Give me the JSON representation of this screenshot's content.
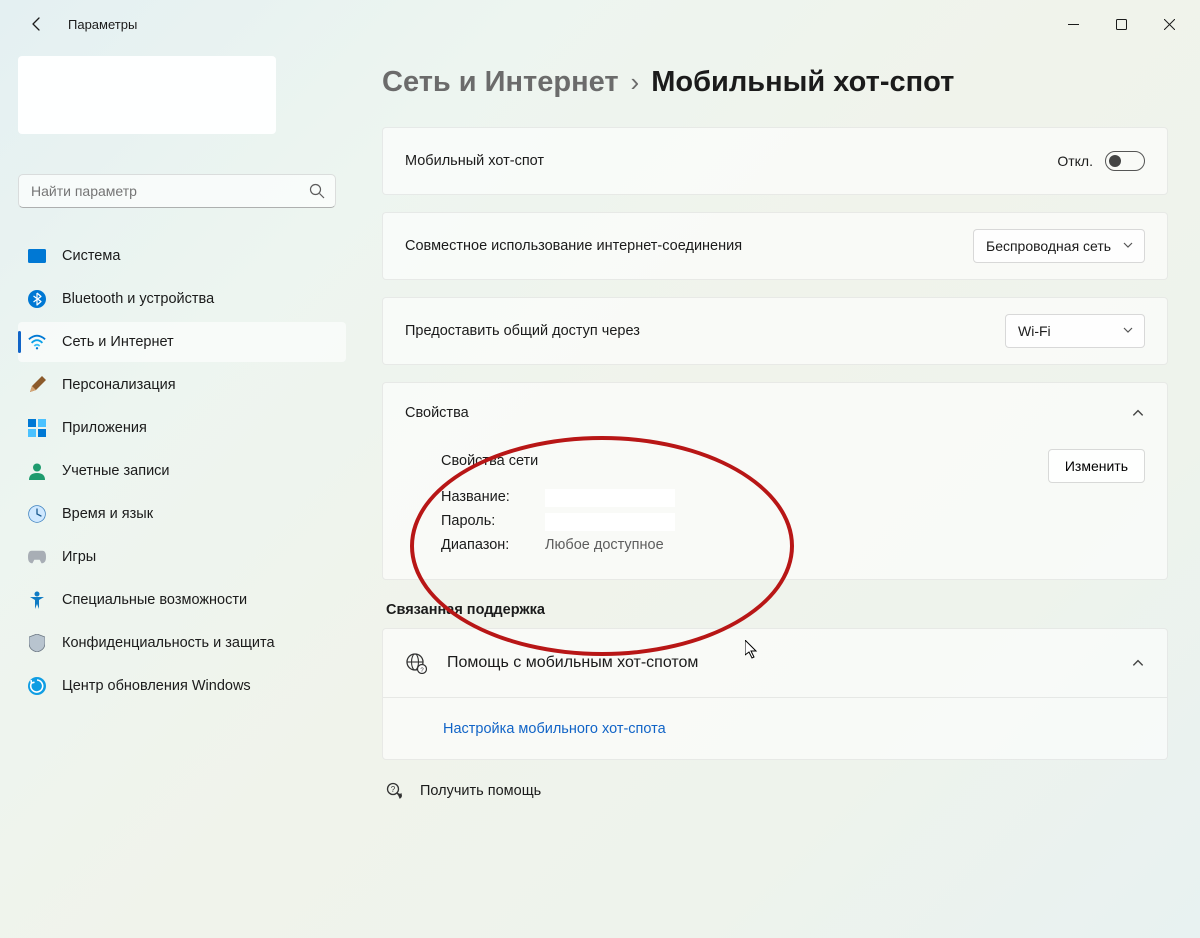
{
  "window": {
    "title": "Параметры",
    "minimize": "−",
    "maximize": "□",
    "close": "×"
  },
  "search": {
    "placeholder": "Найти параметр"
  },
  "nav": {
    "system": "Система",
    "bluetooth": "Bluetooth и устройства",
    "network": "Сеть и Интернет",
    "personalization": "Персонализация",
    "apps": "Приложения",
    "accounts": "Учетные записи",
    "time": "Время и язык",
    "gaming": "Игры",
    "accessibility": "Специальные возможности",
    "privacy": "Конфиденциальность и защита",
    "update": "Центр обновления Windows"
  },
  "breadcrumb": {
    "parent": "Сеть и Интернет",
    "sep": "›",
    "page": "Мобильный хот-спот"
  },
  "hotspot": {
    "label": "Мобильный хот-спот",
    "state": "Откл."
  },
  "share_connection": {
    "label": "Совместное использование интернет-соединения",
    "value": "Беспроводная сеть"
  },
  "share_over": {
    "label": "Предоставить общий доступ через",
    "value": "Wi-Fi"
  },
  "properties": {
    "header": "Свойства",
    "title": "Свойства сети",
    "name_label": "Название:",
    "pass_label": "Пароль:",
    "band_label": "Диапазон:",
    "band_value": "Любое доступное",
    "edit_btn": "Изменить"
  },
  "support": {
    "heading": "Связанная поддержка",
    "help_row": "Помощь с мобильным хот-спотом",
    "help_link": "Настройка мобильного хот-спота"
  },
  "footer": {
    "get_help": "Получить помощь"
  }
}
